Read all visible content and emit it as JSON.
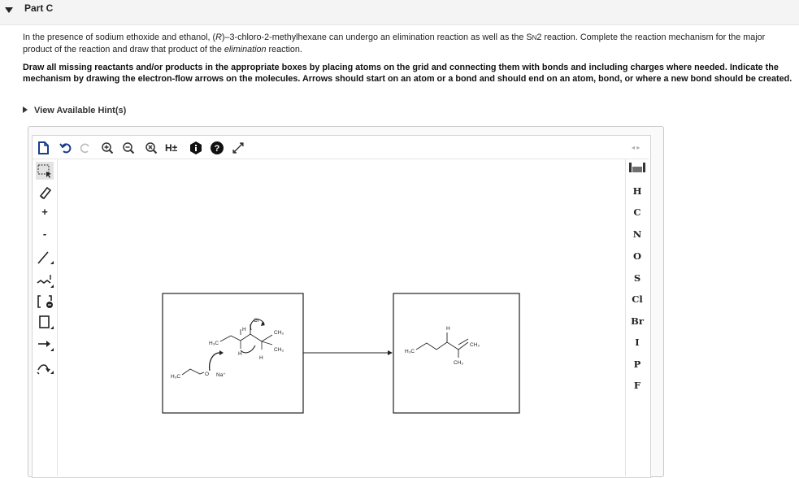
{
  "part": {
    "title": "Part C"
  },
  "question": {
    "intro_pre": "In the presence of sodium ethoxide and ethanol, (",
    "intro_r": "R",
    "intro_mid": ")–3-chloro-2-methylhexane can undergo an elimination reaction as well as the S",
    "intro_sub": "N",
    "intro_num": "2",
    "intro_post": " reaction. Complete the reaction mechanism for the major product of the reaction and draw that product of the ",
    "intro_em": "elimination",
    "intro_end": " reaction.",
    "instructions": "Draw all missing reactants and/or products in the appropriate boxes by placing atoms on the grid and connecting them with bonds and including charges where needed. Indicate the mechanism by drawing the electron-flow arrows on the molecules. Arrows should start on an atom or a bond and should end on an atom, bond, or where a new bond should be created.",
    "hint_label": "View Available Hint(s)"
  },
  "toolbar": {
    "h_toggle": "H±",
    "tools": [
      "new-document-icon",
      "undo-icon",
      "redo-icon",
      "zoom-in-icon",
      "zoom-out-icon",
      "clear-icon",
      "explicit-hydrogens-icon",
      "info-icon",
      "help-icon",
      "fullscreen-icon"
    ]
  },
  "left_tools": {
    "plus": "+",
    "minus": "-",
    "items": [
      "selection-tool-icon",
      "eraser-icon",
      "positive-charge-icon",
      "negative-charge-icon",
      "single-bond-icon",
      "chain-icon",
      "bracket-icon",
      "ring-template-icon",
      "reaction-arrow-icon",
      "curved-arrow-icon"
    ]
  },
  "elements": [
    "H",
    "C",
    "N",
    "O",
    "S",
    "Cl",
    "Br",
    "I",
    "P",
    "F"
  ],
  "nav": "◂ ▸",
  "reactant": {
    "ethoxide_label": "H₃C",
    "o_label": "O",
    "na_label": "Na⁺",
    "left_ch3": "H₃C",
    "cl_label": "Cl",
    "h_labels": [
      "H",
      "H",
      "H"
    ],
    "top_ch3": "CH₃",
    "bottom_ch3": "CH₃"
  },
  "product": {
    "left_ch3": "H₃C",
    "h_label": "H",
    "right_ch3": "CH₃",
    "bottom_ch3": "CH₃"
  },
  "colors": {
    "accent": "#222222",
    "header_bg": "#f4f4f4",
    "border": "#c8c8c8"
  }
}
